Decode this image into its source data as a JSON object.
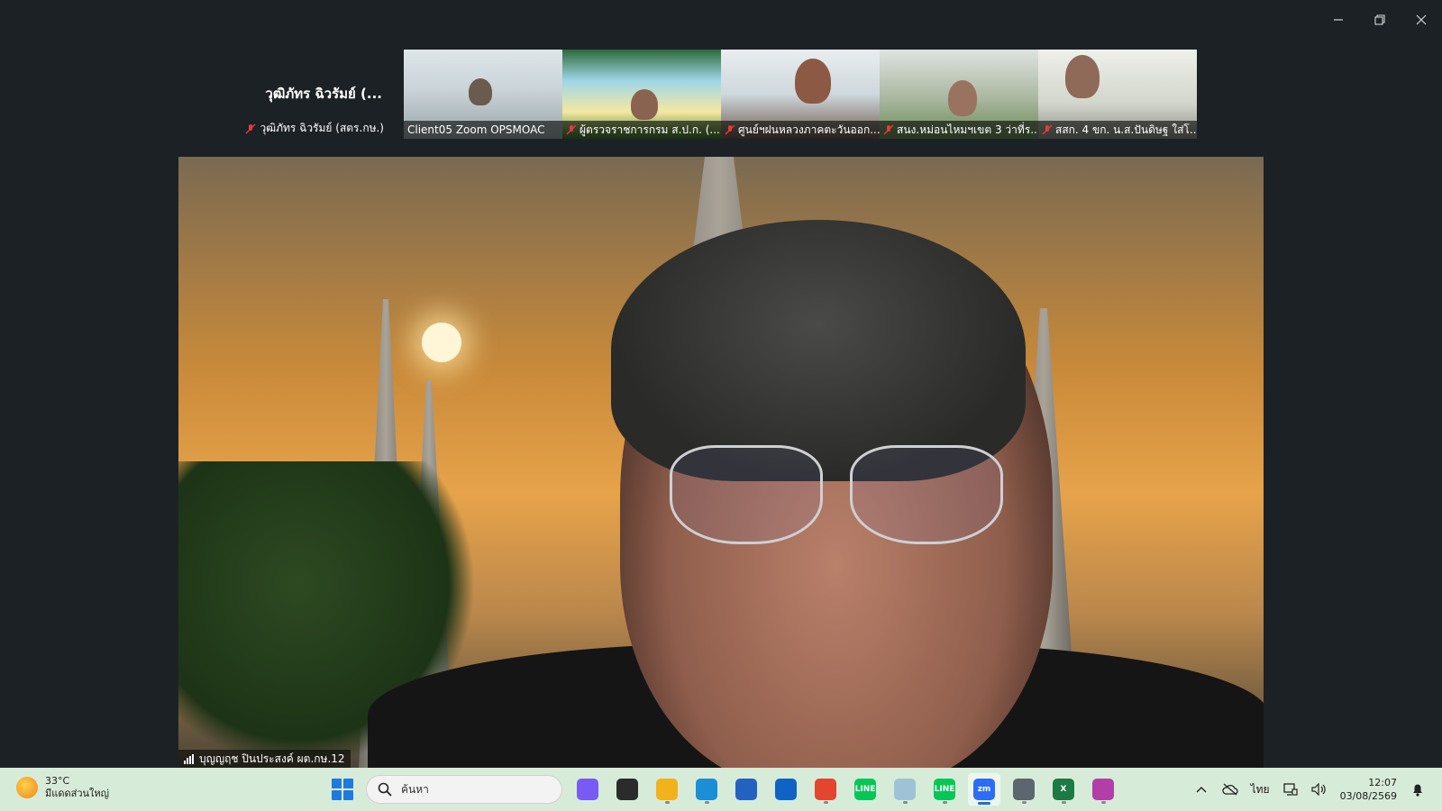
{
  "window": {
    "minimize_icon": "minimize-icon",
    "restore_icon": "restore-icon",
    "close_icon": "close-icon"
  },
  "self_view": {
    "display_name": "วุฒิภัทร ฉิวรัมย์ (...",
    "label": "วุฒิภัทร ฉิวรัมย์ (สตร.กษ.)"
  },
  "thumbnails": [
    {
      "label": "Client05 Zoom OPSMOAC",
      "muted": false
    },
    {
      "label": "ผู้ตรวจราชการกรม ส.ป.ก. (...",
      "muted": true
    },
    {
      "label": "ศูนย์ฯฝนหลวงภาคตะวันออก...",
      "muted": true
    },
    {
      "label": "สนง.หม่อนไหมฯเขต 3 ว่าที่ร....",
      "muted": true
    },
    {
      "label": "สสก. 4 ขก. น.ส.ปันดิษฐ  ใส่โ...",
      "muted": true
    }
  ],
  "speaker": {
    "label": "บุญญฤช ปินประสงค์ ผต.กษ.12"
  },
  "taskbar": {
    "weather": {
      "temp": "33°C",
      "condition": "มีแดดส่วนใหญ่"
    },
    "search_placeholder": "ค้นหา",
    "apps": [
      {
        "name": "copilot",
        "color": "#7a5af5",
        "text": "",
        "state": ""
      },
      {
        "name": "task-view",
        "color": "#2b2b2b",
        "text": "",
        "state": ""
      },
      {
        "name": "file-explorer",
        "color": "#f2b21c",
        "text": "",
        "state": "running"
      },
      {
        "name": "edge",
        "color": "#1b8ed6",
        "text": "",
        "state": "running"
      },
      {
        "name": "microsoft-store",
        "color": "#2462c2",
        "text": "",
        "state": ""
      },
      {
        "name": "outlook",
        "color": "#0f63c4",
        "text": "",
        "state": ""
      },
      {
        "name": "chrome",
        "color": "#e3452f",
        "text": "",
        "state": "running"
      },
      {
        "name": "line",
        "color": "#06c755",
        "text": "LINE",
        "state": ""
      },
      {
        "name": "notepad",
        "color": "#9fc3d6",
        "text": "",
        "state": "running"
      },
      {
        "name": "line-2",
        "color": "#06c755",
        "text": "LINE",
        "state": "running"
      },
      {
        "name": "zoom",
        "color": "#2d6df6",
        "text": "zm",
        "state": "active"
      },
      {
        "name": "calculator",
        "color": "#5b6670",
        "text": "",
        "state": "running"
      },
      {
        "name": "excel",
        "color": "#1d7a44",
        "text": "X",
        "state": "running"
      },
      {
        "name": "snipping-tool",
        "color": "#b23fa8",
        "text": "",
        "state": "running"
      }
    ],
    "language": "ไทย",
    "time": "12:07",
    "date": "03/08/2569"
  }
}
